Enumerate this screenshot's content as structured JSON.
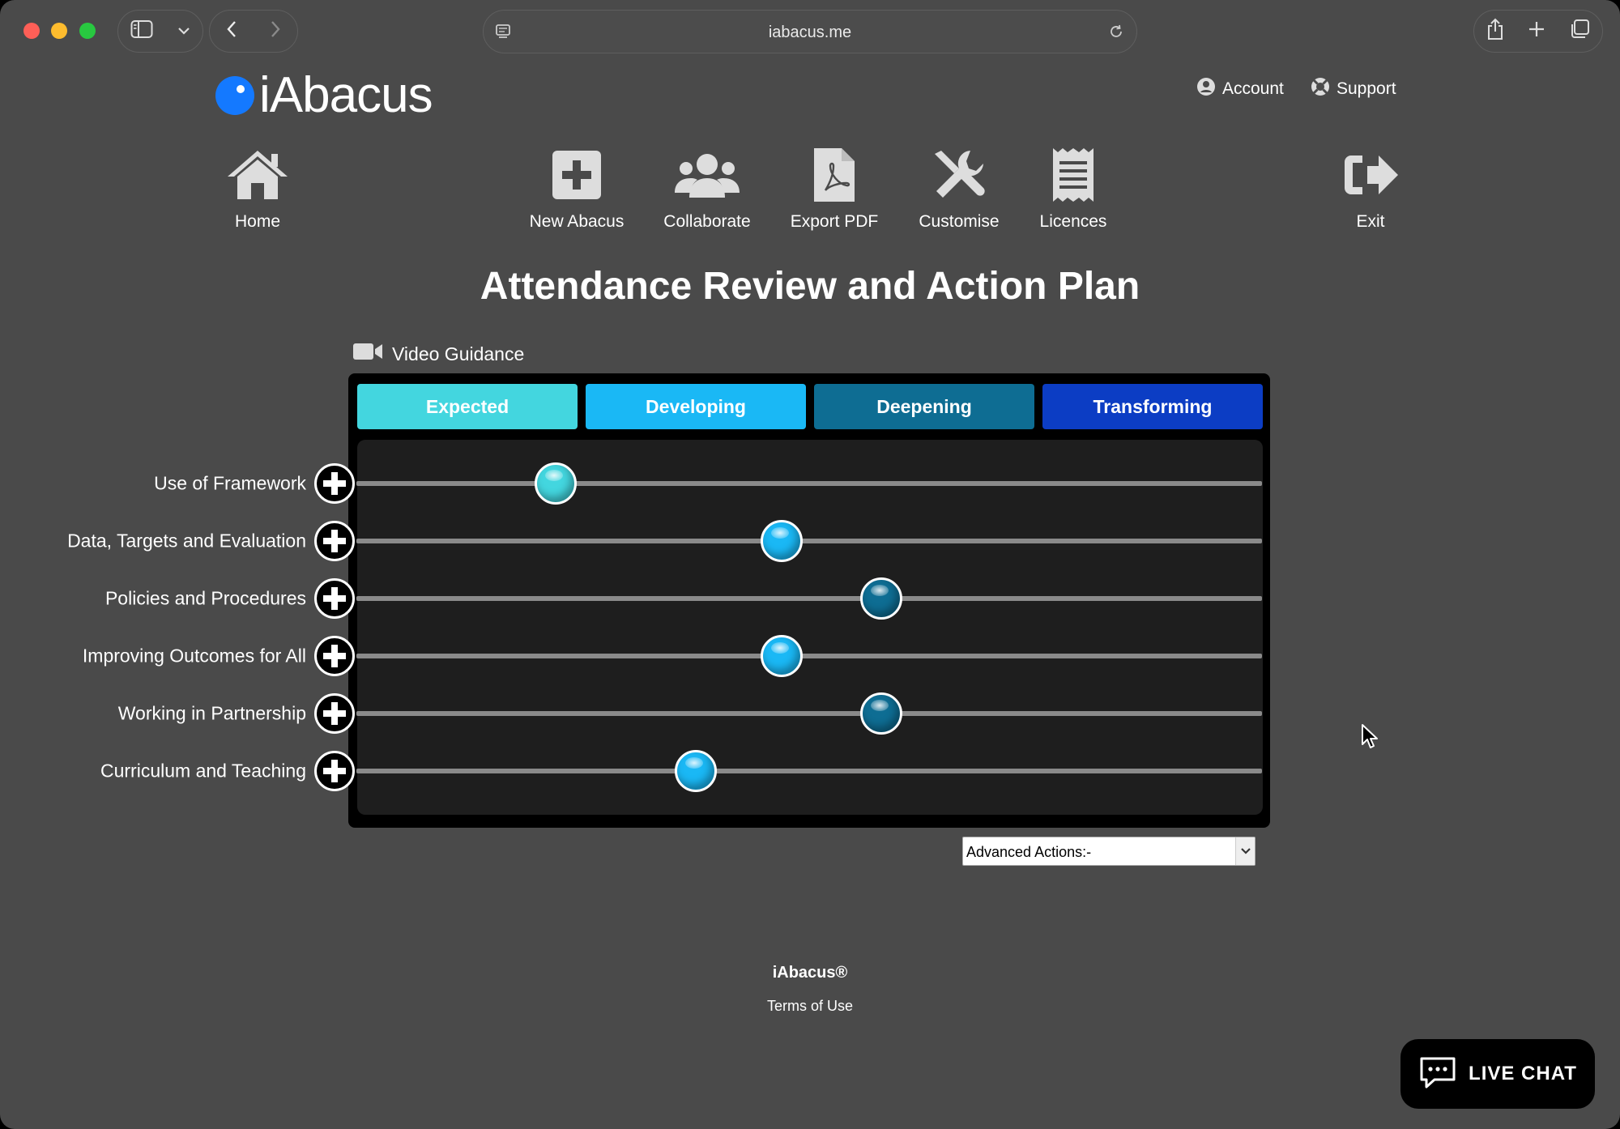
{
  "browser": {
    "url": "iabacus.me"
  },
  "site": {
    "logo_text": "iAbacus",
    "top_links": [
      {
        "label": "Account",
        "icon": "user-circle-icon"
      },
      {
        "label": "Support",
        "icon": "lifebuoy-icon"
      }
    ],
    "nav": [
      {
        "label": "Home",
        "icon": "home-icon"
      },
      {
        "label": "New Abacus",
        "icon": "plus-square-icon"
      },
      {
        "label": "Collaborate",
        "icon": "users-icon"
      },
      {
        "label": "Export PDF",
        "icon": "pdf-file-icon"
      },
      {
        "label": "Customise",
        "icon": "tools-icon"
      },
      {
        "label": "Licences",
        "icon": "receipt-icon"
      },
      {
        "label": "Exit",
        "icon": "exit-icon"
      }
    ]
  },
  "page": {
    "title": "Attendance Review and Action Plan",
    "video_guidance": "Video Guidance"
  },
  "abacus": {
    "stages": [
      {
        "label": "Expected",
        "color": "#43d6df"
      },
      {
        "label": "Developing",
        "color": "#1ab8f5"
      },
      {
        "label": "Deepening",
        "color": "#0e6d93"
      },
      {
        "label": "Transforming",
        "color": "#0c3dc4"
      }
    ],
    "rows": [
      {
        "label": "Use of Framework",
        "position": 0.22,
        "bead_color": "#43d6df"
      },
      {
        "label": "Data, Targets and Evaluation",
        "position": 0.47,
        "bead_color": "#1ab8f5"
      },
      {
        "label": "Policies and Procedures",
        "position": 0.58,
        "bead_color": "#0e6d93"
      },
      {
        "label": "Improving Outcomes for All",
        "position": 0.47,
        "bead_color": "#1ab8f5"
      },
      {
        "label": "Working in Partnership",
        "position": 0.58,
        "bead_color": "#0e6d93"
      },
      {
        "label": "Curriculum and Teaching",
        "position": 0.375,
        "bead_color": "#1ab8f5"
      }
    ]
  },
  "advanced_actions": {
    "selected": "Advanced Actions:-"
  },
  "footer": {
    "brand": "iAbacus®",
    "terms": "Terms of Use"
  },
  "live_chat": {
    "label": "LIVE CHAT"
  }
}
